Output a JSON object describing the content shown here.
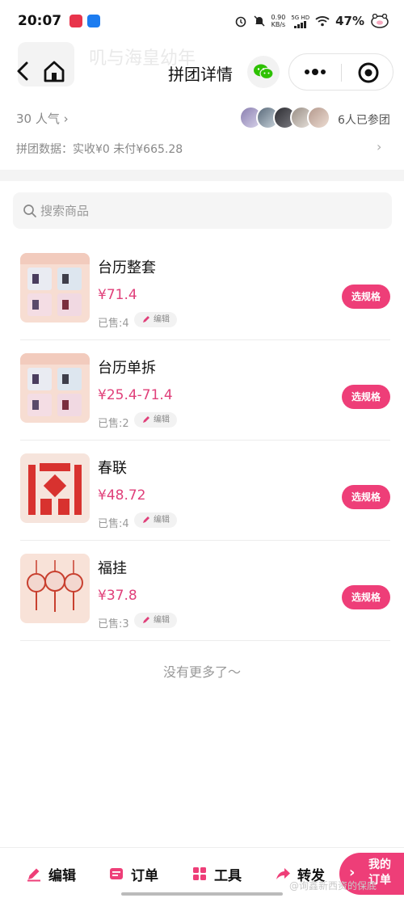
{
  "status_bar": {
    "time": "20:07",
    "net_speed_value": "0.90",
    "net_speed_unit": "KB/s",
    "network": "5G HD",
    "battery": "47%"
  },
  "header": {
    "ghost_title": "叽与海皇幼年",
    "title": "拼团详情"
  },
  "summary": {
    "popularity": "30 人气 ›",
    "joined": "6人已参团",
    "stats": "拼团数据：实收¥0  未付¥665.28",
    "stats_arrow": "›"
  },
  "search": {
    "placeholder": "搜索商品"
  },
  "products": [
    {
      "name": "台历整套",
      "price": "¥71.4",
      "sold": "已售:4",
      "edit": "编辑",
      "action": "选规格"
    },
    {
      "name": "台历单拆",
      "price": "¥25.4-71.4",
      "sold": "已售:2",
      "edit": "编辑",
      "action": "选规格"
    },
    {
      "name": "春联",
      "price": "¥48.72",
      "sold": "已售:4",
      "edit": "编辑",
      "action": "选规格"
    },
    {
      "name": "福挂",
      "price": "¥37.8",
      "sold": "已售:3",
      "edit": "编辑",
      "action": "选规格"
    }
  ],
  "no_more": "没有更多了～",
  "bottom_bar": {
    "edit": "编辑",
    "orders": "订单",
    "tools": "工具",
    "share": "转发",
    "my_orders": "我的订单"
  },
  "watermark": "@询鑫新西资的保底",
  "colors": {
    "accent": "#ee3e78",
    "price": "#e0407a"
  }
}
